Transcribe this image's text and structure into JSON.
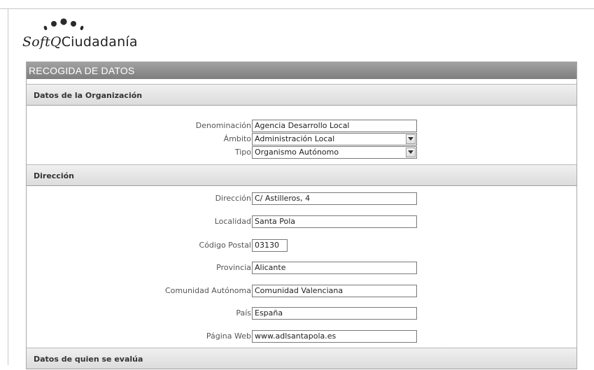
{
  "app": {
    "logo_text_italic": "SoftQ",
    "logo_text": "Ciudadanía"
  },
  "panel": {
    "title": "RECOGIDA DE DATOS"
  },
  "sections": {
    "organizacion": {
      "title": "Datos de la Organización",
      "fields": {
        "denominacion": {
          "label": "Denominación",
          "value": "Agencia Desarrollo Local"
        },
        "ambito": {
          "label": "Ámbito",
          "value": "Administración Local"
        },
        "tipo": {
          "label": "Tipo",
          "value": "Organismo Autónomo"
        }
      }
    },
    "direccion": {
      "title": "Dirección",
      "fields": {
        "direccion": {
          "label": "Dirección",
          "value": "C/ Astilleros, 4"
        },
        "localidad": {
          "label": "Localidad",
          "value": "Santa Pola"
        },
        "codigo_postal": {
          "label": "Código Postal",
          "value": "03130"
        },
        "provincia": {
          "label": "Provincia",
          "value": "Alicante"
        },
        "comunidad": {
          "label": "Comunidad Autónoma",
          "value": "Comunidad Valenciana"
        },
        "pais": {
          "label": "País",
          "value": "España"
        },
        "web": {
          "label": "Página Web",
          "value": "www.adlsantapola.es"
        }
      }
    },
    "evaluado": {
      "title": "Datos de quien se evalúa"
    }
  },
  "colors": {
    "header_bar": "#8c8c8c",
    "section_bg": "#e6e6e6"
  }
}
